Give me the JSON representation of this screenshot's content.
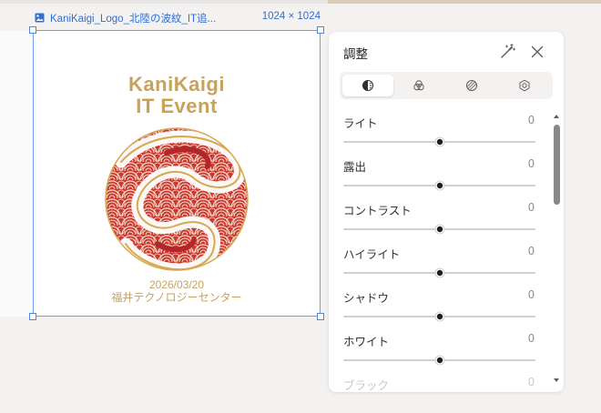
{
  "image": {
    "filename": "KaniKaigi_Logo_北陸の波紋_IT追...",
    "dimensions": "1024 × 1024",
    "logo": {
      "title_line1": "KaniKaigi",
      "title_line2": "IT Event",
      "date": "2026/03/20",
      "venue": "福井テクノロジーセンター"
    }
  },
  "panel": {
    "title": "調整",
    "tabs": [
      {
        "icon": "light-tab-icon",
        "active": true
      },
      {
        "icon": "color-tab-icon",
        "active": false
      },
      {
        "icon": "effects-tab-icon",
        "active": false
      },
      {
        "icon": "advanced-tab-icon",
        "active": false
      }
    ],
    "sliders": [
      {
        "name": "light",
        "label": "ライト",
        "value": "0",
        "level": 0.5
      },
      {
        "name": "exposure",
        "label": "露出",
        "value": "0",
        "level": 0.5
      },
      {
        "name": "contrast",
        "label": "コントラスト",
        "value": "0",
        "level": 0.5
      },
      {
        "name": "highlights",
        "label": "ハイライト",
        "value": "0",
        "level": 0.5
      },
      {
        "name": "shadows",
        "label": "シャドウ",
        "value": "0",
        "level": 0.5
      },
      {
        "name": "whites",
        "label": "ホワイト",
        "value": "0",
        "level": 0.5
      },
      {
        "name": "blacks",
        "label": "ブラック",
        "value": "0",
        "level": 0.5
      }
    ]
  },
  "colors": {
    "selection": "#4a86e8",
    "gold": "#c9a25a",
    "emblem_red": "#c93a30"
  }
}
